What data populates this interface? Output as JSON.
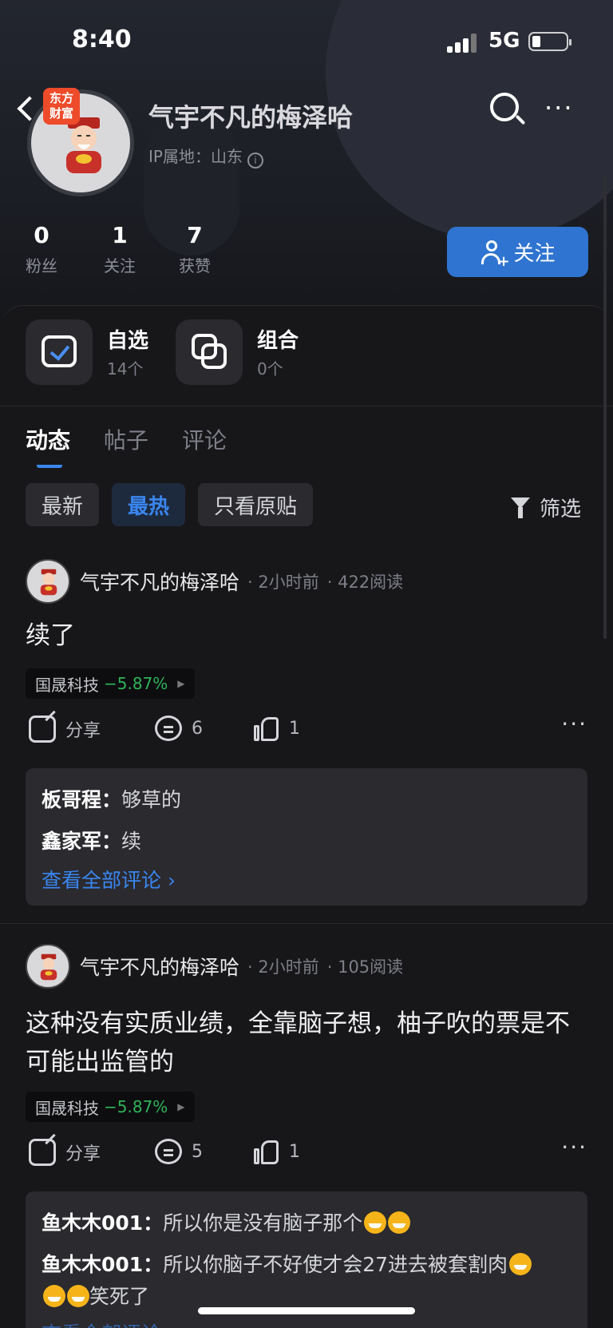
{
  "status_bar": {
    "time": "8:40",
    "network": "5G"
  },
  "profile": {
    "name": "气宇不凡的梅泽哈",
    "ip_location": "IP属地：山东",
    "brand_badge": "东方\n财富",
    "stats": [
      {
        "value": "0",
        "label": "粉丝"
      },
      {
        "value": "1",
        "label": "关注"
      },
      {
        "value": "7",
        "label": "获赞"
      }
    ],
    "follow_label": "关注"
  },
  "shortcuts": [
    {
      "title": "自选",
      "sub": "14个"
    },
    {
      "title": "组合",
      "sub": "0个"
    }
  ],
  "tabs": [
    {
      "label": "动态",
      "active": true
    },
    {
      "label": "帖子",
      "active": false
    },
    {
      "label": "评论",
      "active": false
    }
  ],
  "filters": {
    "chips": [
      {
        "label": "最新",
        "active": false
      },
      {
        "label": "最热",
        "active": true
      },
      {
        "label": "只看原贴",
        "active": false
      }
    ],
    "filter_label": "筛选"
  },
  "posts": [
    {
      "author": "气宇不凡的梅泽哈",
      "time": "· 2小时前",
      "reads": "· 422阅读",
      "text": "续了",
      "stock": {
        "name": "国晟科技",
        "change": "−5.87%"
      },
      "share_label": "分享",
      "comments_count": "6",
      "likes_count": "1",
      "comments": [
        {
          "who": "板哥程：",
          "text": "够草的"
        },
        {
          "who": "鑫家军：",
          "text": "续"
        }
      ],
      "see_all": "查看全部评论 ›"
    },
    {
      "author": "气宇不凡的梅泽哈",
      "time": "· 2小时前",
      "reads": "· 105阅读",
      "text": "这种没有实质业绩，全靠脑子想，柚子吹的票是不可能出监管的",
      "stock": {
        "name": "国晟科技",
        "change": "−5.87%"
      },
      "share_label": "分享",
      "comments_count": "5",
      "likes_count": "1",
      "comments": [
        {
          "who": "鱼木木001：",
          "text": "所以你是没有脑子那个"
        },
        {
          "who": "鱼木木001：",
          "text": "所以你脑子不好使才会27进去被套割肉"
        },
        {
          "text": "笑死了"
        }
      ],
      "see_all": "查看全部评论"
    }
  ],
  "colors": {
    "accent": "#2f74d0",
    "down_green": "#2fb35a",
    "bg": "#17171a"
  }
}
